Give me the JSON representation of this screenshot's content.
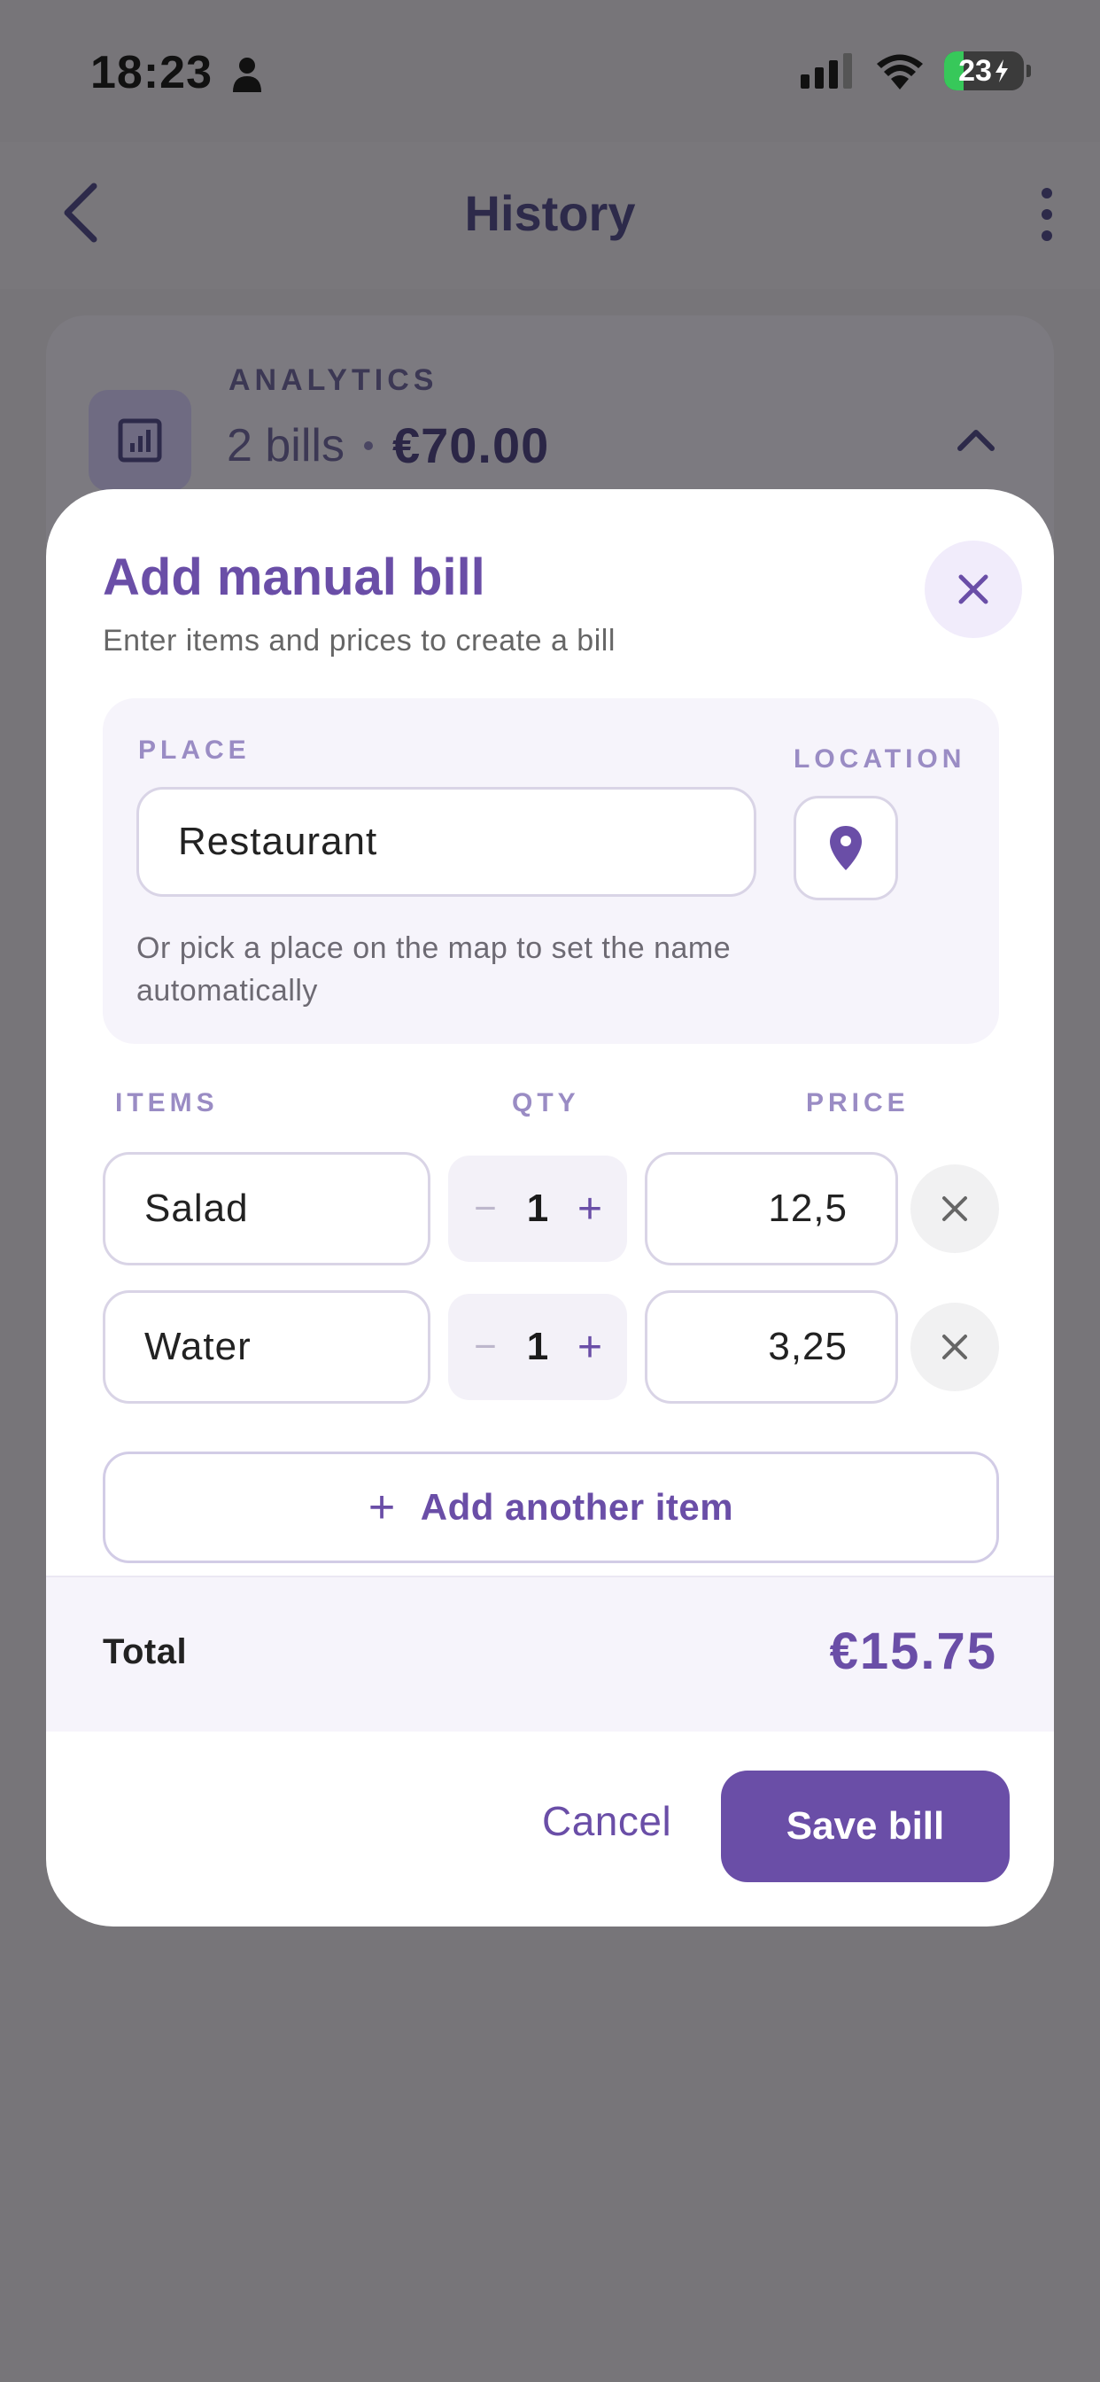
{
  "status_bar": {
    "time": "18:23",
    "battery": "23"
  },
  "header": {
    "title": "History"
  },
  "analytics": {
    "label": "ANALYTICS",
    "bills": "2 bills",
    "amount": "€70.00"
  },
  "modal": {
    "title": "Add manual bill",
    "subtitle": "Enter items and prices to create a bill",
    "place_label": "PLACE",
    "location_label": "LOCATION",
    "place_value": "Restaurant",
    "place_hint": "Or pick a place on the map to set the name automatically",
    "items_header": {
      "items": "ITEMS",
      "qty": "QTY",
      "price": "PRICE"
    },
    "items": [
      {
        "name": "Salad",
        "qty": "1",
        "price": "12,5"
      },
      {
        "name": "Water",
        "qty": "1",
        "price": "3,25"
      }
    ],
    "add_item_label": "Add another item",
    "total_label": "Total",
    "total_value": "€15.75",
    "cancel_label": "Cancel",
    "save_label": "Save bill"
  },
  "colors": {
    "accent": "#6a4ea7",
    "overlay": "#777579",
    "card": "#f6f4fb"
  }
}
